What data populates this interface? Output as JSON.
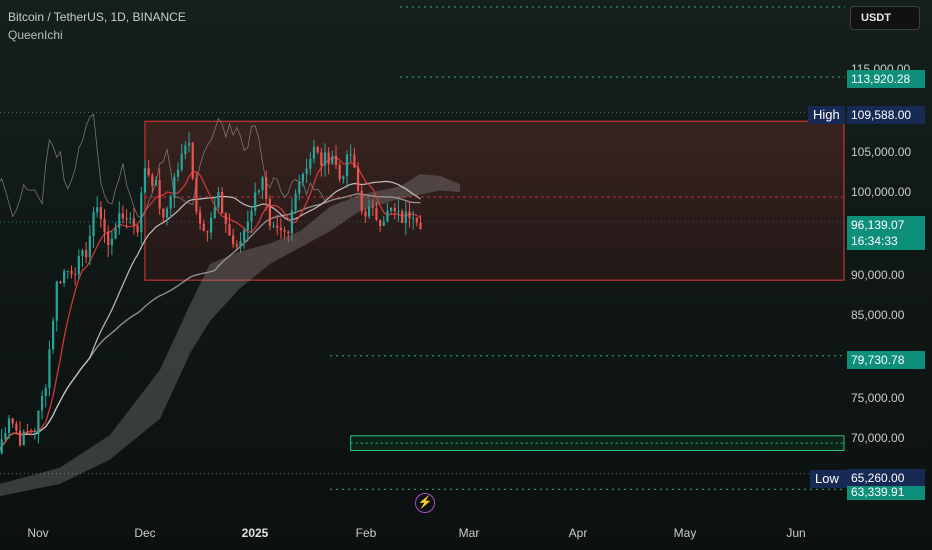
{
  "header": {
    "title": "Bitcoin / TetherUS, 1D, BINANCE",
    "indicator": "QueenIchi",
    "currency_button": "USDT"
  },
  "price_axis": {
    "labels": [
      "105,000.00",
      "100,000.00",
      "90,000.00",
      "85,000.00",
      "75,000.00",
      "70,000.00"
    ],
    "last_price": "96,139.07",
    "countdown": "16:34:33",
    "levels": [
      "113,920.28",
      "79,730.78",
      "63,339.91"
    ],
    "high_tag": "High",
    "high_value": "109,588.00",
    "low_tag": "Low",
    "low_value": "65,260.00",
    "partial_label": "115,000.00"
  },
  "time_axis": [
    "Nov",
    "Dec",
    "2025",
    "Feb",
    "Mar",
    "Apr",
    "May",
    "Jun"
  ],
  "colors": {
    "up": "#26a69a",
    "down": "#ef5350",
    "range_border": "#e03a3a",
    "green_box": "#29c07a",
    "accent": "#0e8f7a",
    "navy_label": "#172a56"
  },
  "icons": {
    "flash": "lightning-icon"
  },
  "chart_data": {
    "type": "candlestick",
    "symbol": "BTC/USDT",
    "interval": "1D",
    "exchange": "BINANCE",
    "indicator": "QueenIchi",
    "x_range": [
      "2024-10-26",
      "2025-06-10"
    ],
    "y_range": [
      61500,
      119000
    ],
    "last_price": 96139.07,
    "high": 109588.0,
    "low": 65260.0,
    "levels": [
      113920.28,
      79730.78,
      63339.91
    ],
    "range_box": {
      "from": "2024-12-05",
      "to": "2025-06-10",
      "top": 108500,
      "bottom": 89000
    },
    "support_box": {
      "from": "2025-01-30",
      "to": "2025-06-10",
      "top": 69900,
      "bottom": 68100
    },
    "closes": [
      {
        "date": "2024-10-26",
        "close": 67800
      },
      {
        "date": "2024-10-29",
        "close": 72500
      },
      {
        "date": "2024-11-01",
        "close": 69500
      },
      {
        "date": "2024-11-05",
        "close": 70500
      },
      {
        "date": "2024-11-08",
        "close": 76500
      },
      {
        "date": "2024-11-11",
        "close": 88500
      },
      {
        "date": "2024-11-13",
        "close": 90000
      },
      {
        "date": "2024-11-16",
        "close": 90500
      },
      {
        "date": "2024-11-19",
        "close": 92500
      },
      {
        "date": "2024-11-22",
        "close": 98500
      },
      {
        "date": "2024-11-25",
        "close": 93000
      },
      {
        "date": "2024-11-27",
        "close": 96000
      },
      {
        "date": "2024-11-30",
        "close": 97000
      },
      {
        "date": "2024-12-03",
        "close": 95500
      },
      {
        "date": "2024-12-05",
        "close": 103000
      },
      {
        "date": "2024-12-08",
        "close": 100500
      },
      {
        "date": "2024-12-10",
        "close": 96000
      },
      {
        "date": "2024-12-13",
        "close": 101500
      },
      {
        "date": "2024-12-17",
        "close": 106500
      },
      {
        "date": "2024-12-19",
        "close": 97500
      },
      {
        "date": "2024-12-22",
        "close": 95000
      },
      {
        "date": "2024-12-25",
        "close": 99000
      },
      {
        "date": "2024-12-28",
        "close": 94500
      },
      {
        "date": "2024-12-30",
        "close": 92500
      },
      {
        "date": "2025-01-03",
        "close": 98000
      },
      {
        "date": "2025-01-06",
        "close": 102000
      },
      {
        "date": "2025-01-08",
        "close": 95000
      },
      {
        "date": "2025-01-11",
        "close": 94500
      },
      {
        "date": "2025-01-13",
        "close": 94500
      },
      {
        "date": "2025-01-15",
        "close": 100500
      },
      {
        "date": "2025-01-20",
        "close": 105000
      },
      {
        "date": "2025-01-22",
        "close": 103500
      },
      {
        "date": "2025-01-25",
        "close": 104500
      },
      {
        "date": "2025-01-27",
        "close": 101500
      },
      {
        "date": "2025-01-30",
        "close": 104500
      },
      {
        "date": "2025-02-02",
        "close": 97500
      },
      {
        "date": "2025-02-04",
        "close": 97500
      },
      {
        "date": "2025-02-07",
        "close": 96500
      },
      {
        "date": "2025-02-10",
        "close": 97500
      },
      {
        "date": "2025-02-13",
        "close": 96500
      },
      {
        "date": "2025-02-16",
        "close": 97500
      },
      {
        "date": "2025-02-18",
        "close": 96139.07
      }
    ]
  }
}
